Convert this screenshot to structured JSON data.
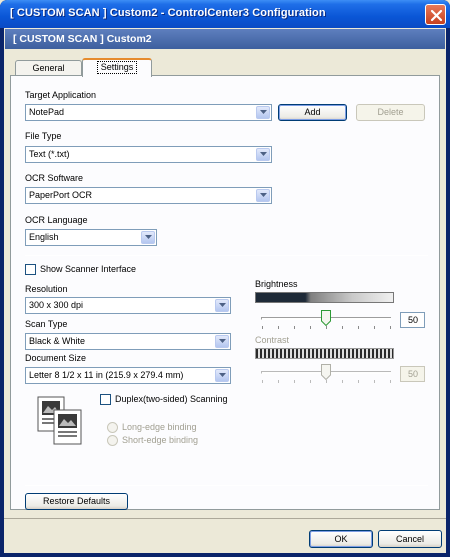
{
  "window": {
    "title": "[ CUSTOM SCAN ]   Custom2 - ControlCenter3 Configuration"
  },
  "header": {
    "title": "[ CUSTOM SCAN ]    Custom2"
  },
  "tabs": [
    {
      "label": "General",
      "active": false
    },
    {
      "label": "Settings",
      "active": true
    }
  ],
  "target_application": {
    "label": "Target Application",
    "value": "NotePad",
    "add_label": "Add",
    "delete_label": "Delete"
  },
  "file_type": {
    "label": "File Type",
    "value": "Text (*.txt)"
  },
  "ocr_software": {
    "label": "OCR Software",
    "value": "PaperPort OCR"
  },
  "ocr_language": {
    "label": "OCR Language",
    "value": "English"
  },
  "show_scanner_interface": {
    "label": "Show Scanner Interface",
    "checked": false
  },
  "resolution": {
    "label": "Resolution",
    "value": "300 x 300 dpi"
  },
  "scan_type": {
    "label": "Scan Type",
    "value": "Black & White"
  },
  "document_size": {
    "label": "Document Size",
    "value": "Letter 8 1/2 x 11 in (215.9 x 279.4 mm)"
  },
  "brightness": {
    "label": "Brightness",
    "value": "50"
  },
  "contrast": {
    "label": "Contrast",
    "value": "50",
    "enabled": false
  },
  "duplex": {
    "label": "Duplex(two-sided) Scanning",
    "checked": false
  },
  "binding": {
    "long_edge": "Long-edge binding",
    "short_edge": "Short-edge binding"
  },
  "restore_defaults_label": "Restore Defaults",
  "ok_label": "OK",
  "cancel_label": "Cancel",
  "colors": {
    "title_blue": "#0a56d6",
    "header_band": "#4a6dad",
    "tab_highlight": "#e68b2c",
    "dialog_bg": "#ece9d8"
  }
}
